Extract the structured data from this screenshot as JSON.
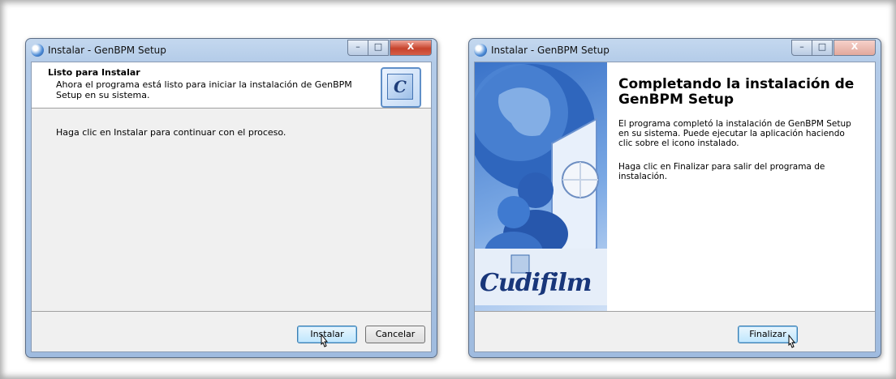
{
  "window1": {
    "title": "Instalar - GenBPM Setup",
    "heading": "Listo para Instalar",
    "subheading": "Ahora el programa está listo para iniciar la instalación de GenBPM Setup en su sistema.",
    "body": "Haga clic en Instalar para continuar con el proceso.",
    "install_label": "Instalar",
    "cancel_label": "Cancelar",
    "logo_letter": "C",
    "controls": {
      "min": "–",
      "max": "□",
      "close": "X"
    }
  },
  "window2": {
    "title": "Instalar - GenBPM Setup",
    "heading": "Completando la instalación de GenBPM Setup",
    "paragraph1": "El programa completó la instalación de GenBPM Setup en su sistema. Puede ejecutar la aplicación haciendo clic sobre el icono instalado.",
    "paragraph2": "Haga clic en Finalizar para salir del programa de instalación.",
    "finish_label": "Finalizar",
    "brand": "Cudifilm",
    "controls": {
      "min": "–",
      "max": "□",
      "close": "X"
    }
  },
  "colors": {
    "window_frame": "#b3cbe8",
    "close_active": "#c7432c",
    "sidebar_blue": "#3a73c9",
    "brand_text": "#18367a"
  }
}
